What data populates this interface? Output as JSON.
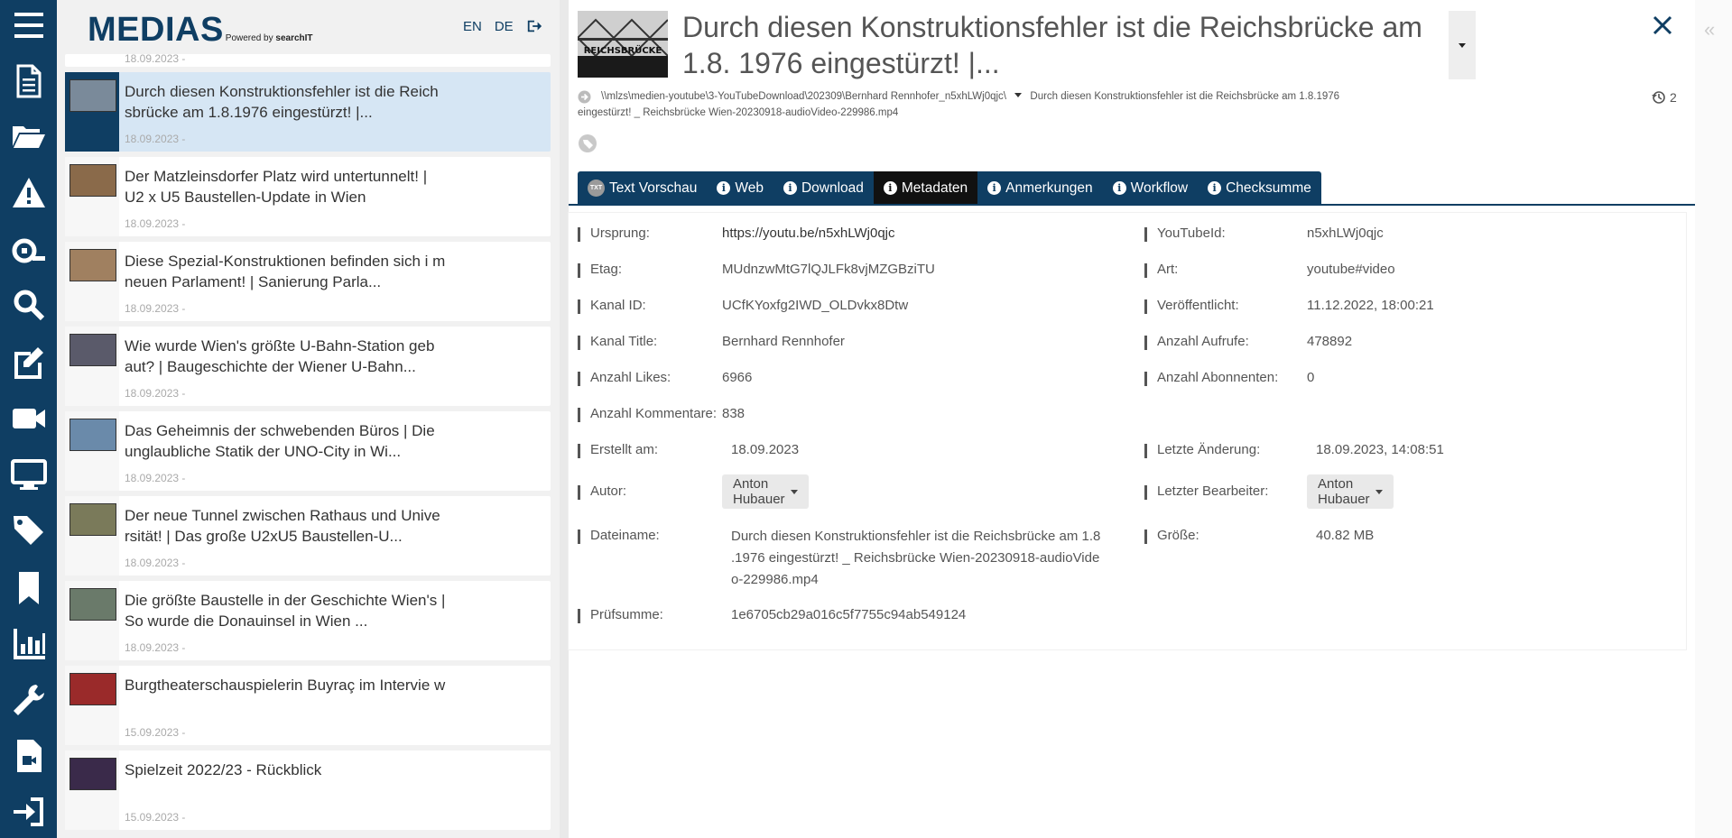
{
  "brand": {
    "logo": "MEDIAS",
    "powered_prefix": "Powered by ",
    "powered_name": "searchIT"
  },
  "lang": {
    "en": "EN",
    "de": "DE"
  },
  "nav": [
    {
      "name": "menu-icon"
    },
    {
      "name": "document-icon"
    },
    {
      "name": "folder-open-icon"
    },
    {
      "name": "warning-icon"
    },
    {
      "name": "search-key-icon"
    },
    {
      "name": "search-icon"
    },
    {
      "name": "edit-icon"
    },
    {
      "name": "video-camera-icon"
    },
    {
      "name": "monitor-icon"
    },
    {
      "name": "tags-icon"
    },
    {
      "name": "bookmark-icon"
    },
    {
      "name": "chart-icon"
    },
    {
      "name": "wrench-icon"
    },
    {
      "name": "file-video-icon"
    },
    {
      "name": "sign-in-icon"
    }
  ],
  "list": {
    "partial_date": "18.09.2023 -",
    "items": [
      {
        "title": "Durch diesen Konstruktionsfehler ist die Reich sbrücke am 1.8.1976 eingestürzt! |...",
        "date": "18.09.2023 -",
        "active": true,
        "thumb": "#7a8a9a"
      },
      {
        "title": "Der Matzleinsdorfer Platz wird untertunnelt! | U2 x U5 Baustellen-Update in Wien",
        "date": "18.09.2023 -",
        "thumb": "#8a6a4a"
      },
      {
        "title": "Diese Spezial-Konstruktionen befinden sich i m neuen Parlament! | Sanierung Parla...",
        "date": "18.09.2023 -",
        "thumb": "#a08060"
      },
      {
        "title": "Wie wurde Wien's größte U-Bahn-Station geb aut? | Baugeschichte der Wiener U-Bahn...",
        "date": "18.09.2023 -",
        "thumb": "#5a5a6a"
      },
      {
        "title": "Das Geheimnis der schwebenden Büros | Die unglaubliche Statik der UNO-City in Wi...",
        "date": "18.09.2023 -",
        "thumb": "#6a8aaa"
      },
      {
        "title": "Der neue Tunnel zwischen Rathaus und Unive rsität! | Das große U2xU5 Baustellen-U...",
        "date": "18.09.2023 -",
        "thumb": "#7a7a5a"
      },
      {
        "title": "Die größte Baustelle in der Geschichte Wien's | So wurde die Donauinsel in Wien ...",
        "date": "18.09.2023 -",
        "thumb": "#6a7a6a"
      },
      {
        "title": "Burgtheaterschauspielerin Buyraç im Intervie w",
        "date": "15.09.2023 -",
        "thumb": "#9a2a2a"
      },
      {
        "title": "Spielzeit 2022/23 - Rückblick",
        "date": "15.09.2023 -",
        "thumb": "#3a2a4a"
      }
    ]
  },
  "detail": {
    "title": "Durch diesen Konstruktionsfehler ist die Reichsbrücke am 1.8. 1976 eingestürzt! |...",
    "thumb_label": "REICHSBRÜCKE",
    "path_dir": "\\\\mlzs\\medien-youtube\\3-YouTubeDownload\\202309\\Bernhard Rennhofer_n5xhLWj0qjc\\",
    "path_file_1": "Durch diesen Konstruktionsfehler ist die Reichsbrücke am 1.8.1976",
    "path_file_2": "eingestürzt! _ Reichsbrücke Wien-20230918-audioVideo-229986.mp4",
    "history_count": "2"
  },
  "tabs": [
    {
      "label": "Text Vorschau",
      "icon": "txt-icon"
    },
    {
      "label": "Web",
      "icon": "info-icon"
    },
    {
      "label": "Download",
      "icon": "info-icon"
    },
    {
      "label": "Metadaten",
      "icon": "info-icon",
      "active": true
    },
    {
      "label": "Anmerkungen",
      "icon": "info-icon"
    },
    {
      "label": "Workflow",
      "icon": "info-icon"
    },
    {
      "label": "Checksumme",
      "icon": "info-icon"
    }
  ],
  "txt_icon_text": "TXT",
  "meta": {
    "ursprung_label": "Ursprung:",
    "ursprung": "https://youtu.be/n5xhLWj0qjc",
    "youtubeid_label": "YouTubeId:",
    "youtubeid": "n5xhLWj0qjc",
    "etag_label": "Etag:",
    "etag": "MUdnzwMtG7lQJLFk8vjMZGBziTU",
    "art_label": "Art:",
    "art": "youtube#video",
    "kanalid_label": "Kanal ID:",
    "kanalid": "UCfKYoxfg2IWD_OLDvkx8Dtw",
    "veroeff_label": "Veröffentlicht:",
    "veroeff": "11.12.2022, 18:00:21",
    "kanaltitle_label": "Kanal Title:",
    "kanaltitle": "Bernhard Rennhofer",
    "aufrufe_label": "Anzahl Aufrufe:",
    "aufrufe": "478892",
    "likes_label": "Anzahl Likes:",
    "likes": "6966",
    "abonnenten_label": "Anzahl Abonnenten:",
    "abonnenten": "0",
    "kommentare_label": "Anzahl Kommentare:",
    "kommentare": "838",
    "erstellt_label": "Erstellt am:",
    "erstellt": "18.09.2023",
    "aenderung_label": "Letzte Änderung:",
    "aenderung": "18.09.2023, 14:08:51",
    "autor_label": "Autor:",
    "autor": "Anton Hubauer",
    "bearbeiter_label": "Letzter Bearbeiter:",
    "bearbeiter": "Anton Hubauer",
    "dateiname_label": "Dateiname:",
    "dateiname": "Durch diesen Konstruktionsfehler ist die Reichsbrücke am 1.8 .1976 eingestürzt! _ Reichsbrücke Wien-20230918-audioVide o-229986.mp4",
    "groesse_label": "Größe:",
    "groesse": "40.82 MB",
    "pruefsumme_label": "Prüfsumme:",
    "pruefsumme": "1e6705cb29a016c5f7755c94ab549124"
  },
  "colors": {
    "nav": "#0f3e63",
    "active_item": "#d6e6f4",
    "active_tab": "#111111"
  }
}
